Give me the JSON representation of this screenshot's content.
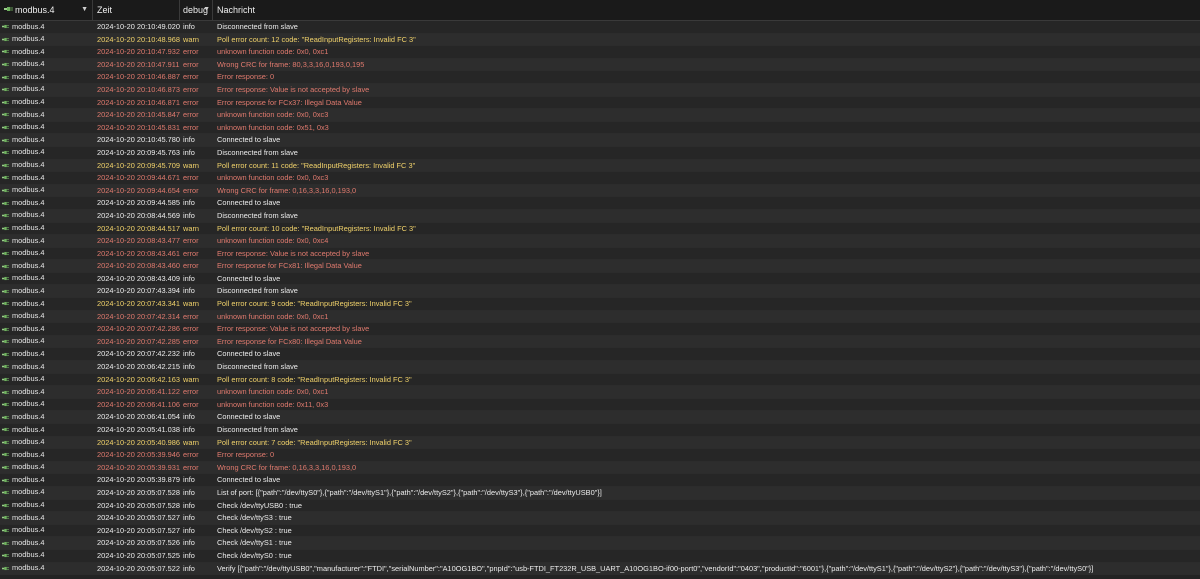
{
  "header": {
    "instance_select": "modbus.4",
    "time_label": "Zeit",
    "level_select": "debug",
    "message_label": "Nachricht"
  },
  "colors": {
    "info": "#ededed",
    "warn": "#f2d36b",
    "error": "#e07a6e",
    "background": "#232323"
  },
  "rows": [
    {
      "instance": "modbus.4",
      "time": "2024-10-20 20:10:49.020",
      "level": "info",
      "message": "Disconnected from slave"
    },
    {
      "instance": "modbus.4",
      "time": "2024-10-20 20:10:48.968",
      "level": "warn",
      "message": "Poll error count: 12 code: \"ReadInputRegisters: Invalid FC 3\""
    },
    {
      "instance": "modbus.4",
      "time": "2024-10-20 20:10:47.932",
      "level": "error",
      "message": "unknown function code: 0x0, 0xc1"
    },
    {
      "instance": "modbus.4",
      "time": "2024-10-20 20:10:47.911",
      "level": "error",
      "message": "Wrong CRC for frame: 80,3,3,16,0,193,0,195"
    },
    {
      "instance": "modbus.4",
      "time": "2024-10-20 20:10:46.887",
      "level": "error",
      "message": "Error response: 0"
    },
    {
      "instance": "modbus.4",
      "time": "2024-10-20 20:10:46.873",
      "level": "error",
      "message": "Error response: Value is not accepted by slave"
    },
    {
      "instance": "modbus.4",
      "time": "2024-10-20 20:10:46.871",
      "level": "error",
      "message": "Error response for FCx37: Illegal Data Value"
    },
    {
      "instance": "modbus.4",
      "time": "2024-10-20 20:10:45.847",
      "level": "error",
      "message": "unknown function code: 0x0, 0xc3"
    },
    {
      "instance": "modbus.4",
      "time": "2024-10-20 20:10:45.831",
      "level": "error",
      "message": "unknown function code: 0x51, 0x3"
    },
    {
      "instance": "modbus.4",
      "time": "2024-10-20 20:10:45.780",
      "level": "info",
      "message": "Connected to slave"
    },
    {
      "instance": "modbus.4",
      "time": "2024-10-20 20:09:45.763",
      "level": "info",
      "message": "Disconnected from slave"
    },
    {
      "instance": "modbus.4",
      "time": "2024-10-20 20:09:45.709",
      "level": "warn",
      "message": "Poll error count: 11 code: \"ReadInputRegisters: Invalid FC 3\""
    },
    {
      "instance": "modbus.4",
      "time": "2024-10-20 20:09:44.671",
      "level": "error",
      "message": "unknown function code: 0x0, 0xc3"
    },
    {
      "instance": "modbus.4",
      "time": "2024-10-20 20:09:44.654",
      "level": "error",
      "message": "Wrong CRC for frame: 0,16,3,3,16,0,193,0"
    },
    {
      "instance": "modbus.4",
      "time": "2024-10-20 20:09:44.585",
      "level": "info",
      "message": "Connected to slave"
    },
    {
      "instance": "modbus.4",
      "time": "2024-10-20 20:08:44.569",
      "level": "info",
      "message": "Disconnected from slave"
    },
    {
      "instance": "modbus.4",
      "time": "2024-10-20 20:08:44.517",
      "level": "warn",
      "message": "Poll error count: 10 code: \"ReadInputRegisters: Invalid FC 3\""
    },
    {
      "instance": "modbus.4",
      "time": "2024-10-20 20:08:43.477",
      "level": "error",
      "message": "unknown function code: 0x0, 0xc4"
    },
    {
      "instance": "modbus.4",
      "time": "2024-10-20 20:08:43.461",
      "level": "error",
      "message": "Error response: Value is not accepted by slave"
    },
    {
      "instance": "modbus.4",
      "time": "2024-10-20 20:08:43.460",
      "level": "error",
      "message": "Error response for FCx81: Illegal Data Value"
    },
    {
      "instance": "modbus.4",
      "time": "2024-10-20 20:08:43.409",
      "level": "info",
      "message": "Connected to slave"
    },
    {
      "instance": "modbus.4",
      "time": "2024-10-20 20:07:43.394",
      "level": "info",
      "message": "Disconnected from slave"
    },
    {
      "instance": "modbus.4",
      "time": "2024-10-20 20:07:43.341",
      "level": "warn",
      "message": "Poll error count: 9 code: \"ReadInputRegisters: Invalid FC 3\""
    },
    {
      "instance": "modbus.4",
      "time": "2024-10-20 20:07:42.314",
      "level": "error",
      "message": "unknown function code: 0x0, 0xc1"
    },
    {
      "instance": "modbus.4",
      "time": "2024-10-20 20:07:42.286",
      "level": "error",
      "message": "Error response: Value is not accepted by slave"
    },
    {
      "instance": "modbus.4",
      "time": "2024-10-20 20:07:42.285",
      "level": "error",
      "message": "Error response for FCx80: Illegal Data Value"
    },
    {
      "instance": "modbus.4",
      "time": "2024-10-20 20:07:42.232",
      "level": "info",
      "message": "Connected to slave"
    },
    {
      "instance": "modbus.4",
      "time": "2024-10-20 20:06:42.215",
      "level": "info",
      "message": "Disconnected from slave"
    },
    {
      "instance": "modbus.4",
      "time": "2024-10-20 20:06:42.163",
      "level": "warn",
      "message": "Poll error count: 8 code: \"ReadInputRegisters: Invalid FC 3\""
    },
    {
      "instance": "modbus.4",
      "time": "2024-10-20 20:06:41.122",
      "level": "error",
      "message": "unknown function code: 0x0, 0xc1"
    },
    {
      "instance": "modbus.4",
      "time": "2024-10-20 20:06:41.106",
      "level": "error",
      "message": "unknown function code: 0x11, 0x3"
    },
    {
      "instance": "modbus.4",
      "time": "2024-10-20 20:06:41.054",
      "level": "info",
      "message": "Connected to slave"
    },
    {
      "instance": "modbus.4",
      "time": "2024-10-20 20:05:41.038",
      "level": "info",
      "message": "Disconnected from slave"
    },
    {
      "instance": "modbus.4",
      "time": "2024-10-20 20:05:40.986",
      "level": "warn",
      "message": "Poll error count: 7 code: \"ReadInputRegisters: Invalid FC 3\""
    },
    {
      "instance": "modbus.4",
      "time": "2024-10-20 20:05:39.946",
      "level": "error",
      "message": "Error response: 0"
    },
    {
      "instance": "modbus.4",
      "time": "2024-10-20 20:05:39.931",
      "level": "error",
      "message": "Wrong CRC for frame: 0,16,3,3,16,0,193,0"
    },
    {
      "instance": "modbus.4",
      "time": "2024-10-20 20:05:39.879",
      "level": "info",
      "message": "Connected to slave"
    },
    {
      "instance": "modbus.4",
      "time": "2024-10-20 20:05:07.528",
      "level": "info",
      "message": "List of port: [{\"path\":\"/dev/ttyS0\"},{\"path\":\"/dev/ttyS1\"},{\"path\":\"/dev/ttyS2\"},{\"path\":\"/dev/ttyS3\"},{\"path\":\"/dev/ttyUSB0\"}]"
    },
    {
      "instance": "modbus.4",
      "time": "2024-10-20 20:05:07.528",
      "level": "info",
      "message": "Check /dev/ttyUSB0 : true"
    },
    {
      "instance": "modbus.4",
      "time": "2024-10-20 20:05:07.527",
      "level": "info",
      "message": "Check /dev/ttyS3 : true"
    },
    {
      "instance": "modbus.4",
      "time": "2024-10-20 20:05:07.527",
      "level": "info",
      "message": "Check /dev/ttyS2 : true"
    },
    {
      "instance": "modbus.4",
      "time": "2024-10-20 20:05:07.526",
      "level": "info",
      "message": "Check /dev/ttyS1 : true"
    },
    {
      "instance": "modbus.4",
      "time": "2024-10-20 20:05:07.525",
      "level": "info",
      "message": "Check /dev/ttyS0 : true"
    },
    {
      "instance": "modbus.4",
      "time": "2024-10-20 20:05:07.522",
      "level": "info",
      "message": "Verify [{\"path\":\"/dev/ttyUSB0\",\"manufacturer\":\"FTDI\",\"serialNumber\":\"A10OG1BO\",\"pnpId\":\"usb-FTDI_FT232R_USB_UART_A10OG1BO-if00-port0\",\"vendorId\":\"0403\",\"productId\":\"6001\"},{\"path\":\"/dev/ttyS1\"},{\"path\":\"/dev/ttyS2\"},{\"path\":\"/dev/ttyS3\"},{\"path\":\"/dev/ttyS0\"}]"
    }
  ]
}
